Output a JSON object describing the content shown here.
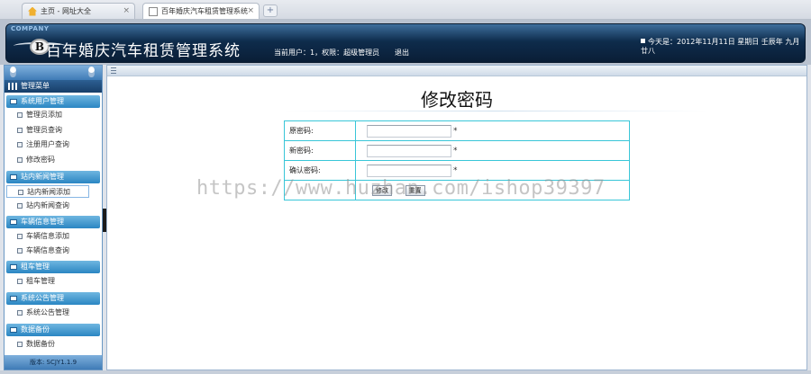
{
  "browser": {
    "tabs": [
      {
        "label": "主页 - 网址大全",
        "close": "×"
      },
      {
        "label": "百年婚庆汽车租赁管理系统",
        "close": "×"
      }
    ],
    "new_tab": "+"
  },
  "header": {
    "company": "COMPANY",
    "logo_letter": "B",
    "title": "百年婚庆汽车租赁管理系统",
    "user_info": "当前用户：1，权限：超级管理员",
    "logout": "退出",
    "date_info": "今天是：2012年11月11日 星期日 壬辰年 九月廿八"
  },
  "sidebar": {
    "menu_title": "管理菜单",
    "groups": [
      {
        "label": "系统用户管理",
        "items": [
          "管理员添加",
          "管理员查询",
          "注册用户查询",
          "修改密码"
        ]
      },
      {
        "label": "站内新闻管理",
        "items": [
          "站内新闻添加",
          "站内新闻查询"
        ]
      },
      {
        "label": "车辆信息管理",
        "items": [
          "车辆信息添加",
          "车辆信息查询"
        ]
      },
      {
        "label": "租车管理",
        "items": [
          "租车管理"
        ]
      },
      {
        "label": "系统公告管理",
        "items": [
          "系统公告管理"
        ]
      },
      {
        "label": "数据备份",
        "items": [
          "数据备份"
        ]
      }
    ],
    "version": "版本: SCJY1.1.9"
  },
  "main": {
    "heading": "修改密码",
    "form": {
      "old_label": "原密码:",
      "new_label": "新密码:",
      "confirm_label": "确认密码:",
      "required_mark": "*",
      "submit_label": "修改",
      "reset_label": "重置"
    }
  },
  "watermark": "https://www.huzhan.com/ishop39397",
  "colors": {
    "header_dark": "#0e2c4c",
    "sidebar_group": "#2b86c3",
    "form_border": "#39c6d8"
  }
}
